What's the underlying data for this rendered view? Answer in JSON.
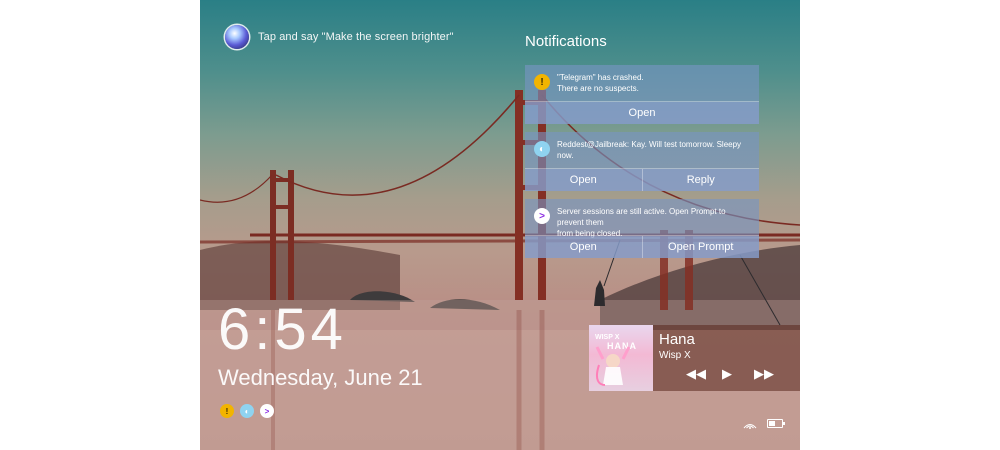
{
  "assistant": {
    "hint": "Tap and say \"Make the screen brighter\"",
    "icon": "assistant-orb-icon"
  },
  "notifications": {
    "title": "Notifications",
    "items": [
      {
        "icon": "warning-icon",
        "icon_color": "#f2b400",
        "message_line1": "\"Telegram\" has crashed.",
        "message_line2": "There are no suspects.",
        "actions": [
          "Open"
        ]
      },
      {
        "icon": "reddest-icon",
        "icon_color": "#8fd3f0",
        "message_line1": "Reddest@Jailbreak: Kay. Will test tomorrow. Sleepy now.",
        "message_line2": "",
        "actions": [
          "Open",
          "Reply"
        ]
      },
      {
        "icon": "prompt-icon",
        "icon_color": "#8a2be2",
        "message_line1": "Server sessions are still active. Open Prompt to prevent them",
        "message_line2": "from being closed.",
        "actions": [
          "Open",
          "Open Prompt"
        ]
      }
    ]
  },
  "lockscreen": {
    "time": "6:54",
    "date": "Wednesday, June 21"
  },
  "mini_icons": [
    "warning-icon",
    "reddest-icon",
    "prompt-icon"
  ],
  "music": {
    "song": "Hana",
    "artist": "Wisp X",
    "art_text1": "WISP X",
    "art_text2": "HANA",
    "controls": {
      "prev": "◀◀",
      "play": "▶",
      "next": "▶▶"
    }
  },
  "status": {
    "battery_level": 0.5
  }
}
